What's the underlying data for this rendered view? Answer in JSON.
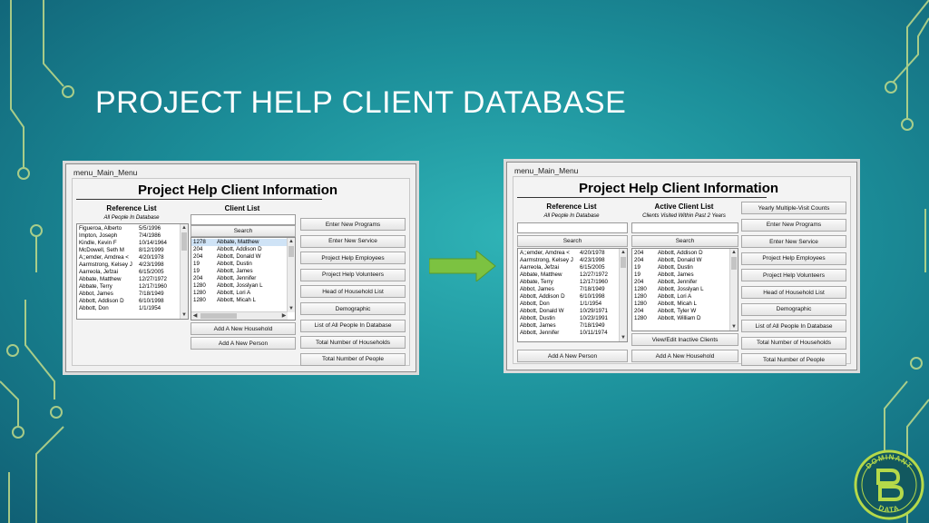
{
  "slide": {
    "title": "PROJECT HELP CLIENT DATABASE"
  },
  "logo": {
    "top_text": "DOMINANT",
    "bottom_text": "DATA"
  },
  "left_window": {
    "title": "menu_Main_Menu",
    "form_title": "Project Help Client Information",
    "reference": {
      "heading": "Reference List",
      "subheading": "All People In Database",
      "rows": [
        [
          "Figueroa, Alberto",
          "5/5/1996"
        ],
        [
          "Impton, Joseph",
          "7/4/1986"
        ],
        [
          "Kindle, Kevin F",
          "10/14/1964"
        ],
        [
          "McDowell, Seth M",
          "8/12/1999"
        ],
        [
          "A;;emder, Amdrea <",
          "4/20/1978"
        ],
        [
          "Aarmstrong, Kelsey J",
          "4/23/1998"
        ],
        [
          "Aarreola, Jefzai",
          "6/15/2005"
        ],
        [
          "Abbate, Matthew",
          "12/27/1972"
        ],
        [
          "Abbate, Terry",
          "12/17/1960"
        ],
        [
          "Abbot, James",
          "7/18/1949"
        ],
        [
          "Abbott, Addison D",
          "6/10/1998"
        ],
        [
          "Abbott, Don",
          "1/1/1954"
        ]
      ]
    },
    "client": {
      "heading": "Client List",
      "search_label": "Search",
      "rows": [
        [
          "1278",
          "Abbate, Matthew"
        ],
        [
          "204",
          "Abbott, Addison D"
        ],
        [
          "204",
          "Abbott, Donald W"
        ],
        [
          "19",
          "Abbott, Dustin"
        ],
        [
          "19",
          "Abbott, James"
        ],
        [
          "204",
          "Abbott, Jennifer"
        ],
        [
          "1280",
          "Abbott, Josslyan L"
        ],
        [
          "1280",
          "Abbott, Lori A"
        ],
        [
          "1280",
          "Abbott, Micah L"
        ]
      ]
    },
    "buttons": {
      "add_household": "Add A New Household",
      "add_person": "Add A New Person",
      "side": [
        "Enter New Programs",
        "Enter New Service",
        "Project Help Employees",
        "Project Help Volunteers",
        "Head of Household List",
        "Demographic",
        "List of All People In Database",
        "Total Number of Households",
        "Total Number of People"
      ]
    }
  },
  "right_window": {
    "title": "menu_Main_Menu",
    "form_title": "Project Help Client Information",
    "reference": {
      "heading": "Reference List",
      "subheading": "All People In Database",
      "search_label": "Search",
      "rows": [
        [
          "A;;emder, Amdrea <",
          "4/20/1978"
        ],
        [
          "Aarmstrong, Kelsey J",
          "4/23/1998"
        ],
        [
          "Aarreola, Jefzai",
          "6/15/2005"
        ],
        [
          "Abbate, Matthew",
          "12/27/1972"
        ],
        [
          "Abbate, Terry",
          "12/17/1960"
        ],
        [
          "Abbot, James",
          "7/18/1949"
        ],
        [
          "Abbott, Addison D",
          "6/10/1998"
        ],
        [
          "Abbott, Don",
          "1/1/1954"
        ],
        [
          "Abbott, Donald W",
          "10/29/1971"
        ],
        [
          "Abbott, Dustin",
          "10/23/1991"
        ],
        [
          "Abbott, James",
          "7/18/1949"
        ],
        [
          "Abbott, Jennifer",
          "10/11/1974"
        ]
      ]
    },
    "active": {
      "heading": "Active Client List",
      "subheading": "Clients Visited Within Past 2 Years",
      "search_label": "Search",
      "rows": [
        [
          "204",
          "Abbott, Addison D"
        ],
        [
          "204",
          "Abbott, Donald W"
        ],
        [
          "19",
          "Abbott, Dustin"
        ],
        [
          "19",
          "Abbott, James"
        ],
        [
          "204",
          "Abbott, Jennifer"
        ],
        [
          "1280",
          "Abbott, Josslyan L"
        ],
        [
          "1280",
          "Abbott, Lori A"
        ],
        [
          "1280",
          "Abbott, Micah L"
        ],
        [
          "204",
          "Abbott, Tyler W"
        ],
        [
          "1280",
          "Abbott, William D"
        ]
      ]
    },
    "buttons": {
      "view_inactive": "View/Edit Inactive Clients",
      "add_person": "Add A New Person",
      "add_household": "Add A New Household",
      "side": [
        "Yearly Multiple-Visit Counts",
        "Enter New Programs",
        "Enter New Service",
        "Project Help Employees",
        "Project Help Volunteers",
        "Head of Household List",
        "Demographic",
        "List of All People In Database",
        "Total Number of Households",
        "Total Number of People"
      ]
    }
  },
  "colors": {
    "accent_arrow": "#7cc241",
    "title_text": "#ffffff"
  }
}
